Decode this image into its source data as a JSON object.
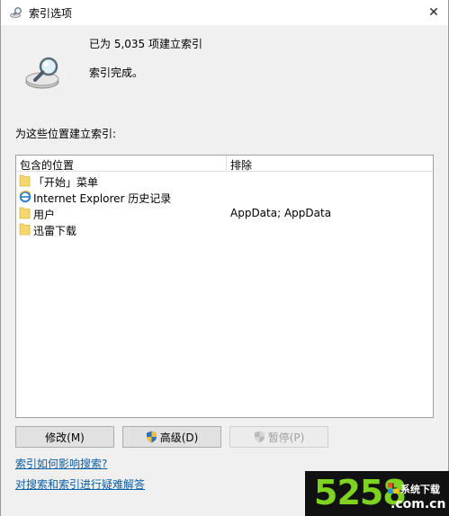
{
  "window": {
    "title": "索引选项",
    "close_glyph": "✕"
  },
  "summary": {
    "count_text": "已为 5,035 项建立索引",
    "status_text": "索引完成。"
  },
  "locations": {
    "section_label": "为这些位置建立索引:",
    "columns": {
      "location": "包含的位置",
      "exclude": "排除"
    },
    "rows": [
      {
        "icon": "folder-icon",
        "location": "「开始」菜单",
        "exclude": ""
      },
      {
        "icon": "internet-explorer-icon",
        "location": "Internet Explorer 历史记录",
        "exclude": ""
      },
      {
        "icon": "folder-icon",
        "location": "用户",
        "exclude": "AppData; AppData"
      },
      {
        "icon": "folder-icon",
        "location": "迅雷下载",
        "exclude": ""
      }
    ]
  },
  "buttons": {
    "modify": "修改(M)",
    "advanced": "高级(D)",
    "pause": "暂停(P)"
  },
  "links": {
    "how_affects": "索引如何影响搜索?",
    "troubleshoot": "对搜索和索引进行疑难解答"
  },
  "watermark": {
    "number": "5258",
    "name": "系统下载",
    "url": ".com.cn"
  },
  "colors": {
    "link": "#0b5fa5",
    "folder": "#f5d76e",
    "watermark_green": "#7ed321",
    "shield_blue": "#2f6fbf",
    "shield_yellow": "#f2c230"
  }
}
